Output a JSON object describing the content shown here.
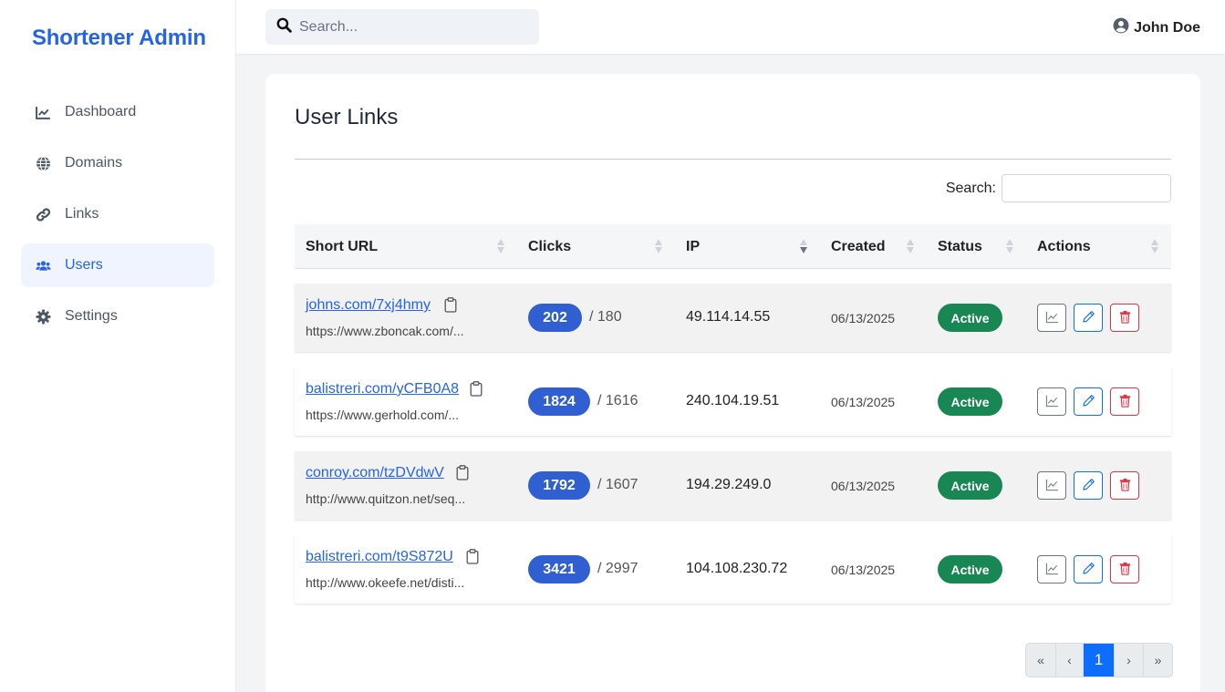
{
  "app": {
    "brand": "Shortener Admin"
  },
  "sidebar": {
    "items": [
      {
        "label": "Dashboard",
        "icon": "chart-line-icon",
        "active": false
      },
      {
        "label": "Domains",
        "icon": "globe-icon",
        "active": false
      },
      {
        "label": "Links",
        "icon": "link-icon",
        "active": false
      },
      {
        "label": "Users",
        "icon": "users-icon",
        "active": true
      },
      {
        "label": "Settings",
        "icon": "gear-icon",
        "active": false
      }
    ]
  },
  "topbar": {
    "search_placeholder": "Search...",
    "user_name": "John Doe"
  },
  "main": {
    "title": "User Links",
    "table_search_label": "Search:",
    "columns": [
      "Short URL",
      "Clicks",
      "IP",
      "Created",
      "Status",
      "Actions"
    ],
    "rows": [
      {
        "short_url": "johns.com/7xj4hmy",
        "long_url": "https://www.zboncak.com/...",
        "clicks": "202",
        "unique": "/ 180",
        "ip": "49.114.14.55",
        "created": "06/13/2025",
        "status": "Active"
      },
      {
        "short_url": "balistreri.com/yCFB0A8",
        "long_url": "https://www.gerhold.com/...",
        "clicks": "1824",
        "unique": "/ 1616",
        "ip": "240.104.19.51",
        "created": "06/13/2025",
        "status": "Active"
      },
      {
        "short_url": "conroy.com/tzDVdwV",
        "long_url": "http://www.quitzon.net/seq...",
        "clicks": "1792",
        "unique": "/ 1607",
        "ip": "194.29.249.0",
        "created": "06/13/2025",
        "status": "Active"
      },
      {
        "short_url": "balistreri.com/t9S872U",
        "long_url": "http://www.okeefe.net/disti...",
        "clicks": "3421",
        "unique": "/ 2997",
        "ip": "104.108.230.72",
        "created": "06/13/2025",
        "status": "Active"
      }
    ],
    "pagination": [
      "«",
      "‹",
      "1",
      "›",
      "»"
    ],
    "current_page": "1"
  },
  "colors": {
    "accent": "#2563eb",
    "pill": "#2f5fd0",
    "status_active": "#198754",
    "danger": "#dc3545",
    "primary": "#0d6efd"
  }
}
